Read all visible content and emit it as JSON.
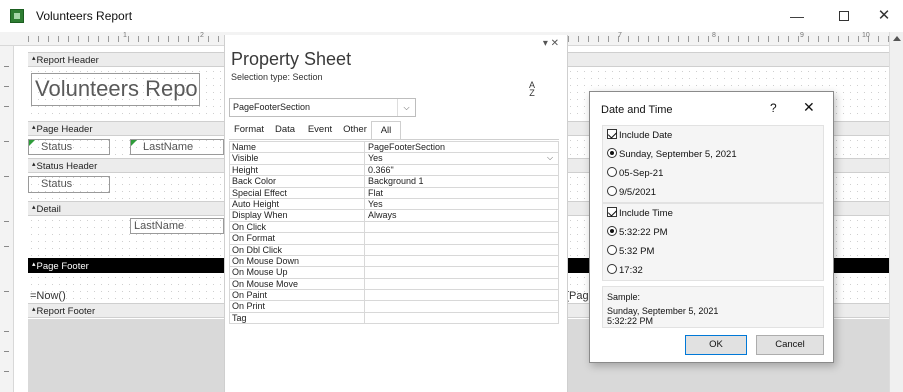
{
  "window": {
    "title": "Volunteers Report"
  },
  "ruler": {
    "numbers": [
      "1",
      "2",
      "7",
      "8",
      "9",
      "10"
    ]
  },
  "report": {
    "bands": {
      "report_header": "Report Header",
      "page_header": "Page Header",
      "status_header": "Status Header",
      "detail": "Detail",
      "page_footer": "Page Footer",
      "report_footer": "Report Footer"
    },
    "controls": {
      "title": "Volunteers Report",
      "status_label": "Status",
      "lastname_label": "LastName",
      "status_field": "Status",
      "lastname_field": "LastName",
      "now_expr": "=Now()",
      "page_expr": "[Page"
    }
  },
  "property_sheet": {
    "title": "Property Sheet",
    "selection_type": "Selection type:  Section",
    "sort_top": "A",
    "sort_bottom": "Z",
    "selected": "PageFooterSection",
    "tabs": [
      "Format",
      "Data",
      "Event",
      "Other",
      "All"
    ],
    "active_tab": "All",
    "rows": [
      {
        "name": "Name",
        "value": "PageFooterSection"
      },
      {
        "name": "Visible",
        "value": "Yes"
      },
      {
        "name": "Height",
        "value": "0.366\""
      },
      {
        "name": "Back Color",
        "value": "Background 1"
      },
      {
        "name": "Special Effect",
        "value": "Flat"
      },
      {
        "name": "Auto Height",
        "value": "Yes"
      },
      {
        "name": "Display When",
        "value": "Always"
      },
      {
        "name": "On Click",
        "value": ""
      },
      {
        "name": "On Format",
        "value": ""
      },
      {
        "name": "On Dbl Click",
        "value": ""
      },
      {
        "name": "On Mouse Down",
        "value": ""
      },
      {
        "name": "On Mouse Up",
        "value": ""
      },
      {
        "name": "On Mouse Move",
        "value": ""
      },
      {
        "name": "On Paint",
        "value": ""
      },
      {
        "name": "On Print",
        "value": ""
      },
      {
        "name": "Tag",
        "value": ""
      }
    ]
  },
  "dialog": {
    "title": "Date and Time",
    "help": "?",
    "close": "✕",
    "include_date": "Include Date",
    "date_formats": [
      "Sunday, September 5, 2021",
      "05-Sep-21",
      "9/5/2021"
    ],
    "include_time": "Include Time",
    "time_formats": [
      "5:32:22 PM",
      "5:32 PM",
      "17:32"
    ],
    "sample_label": "Sample:",
    "sample_line1": "Sunday, September 5, 2021",
    "sample_line2": "5:32:22 PM",
    "ok": "OK",
    "cancel": "Cancel"
  }
}
